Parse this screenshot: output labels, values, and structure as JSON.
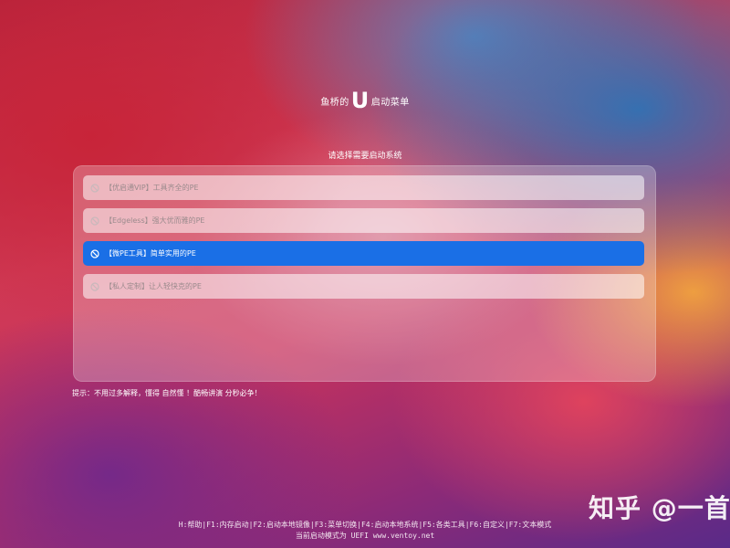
{
  "header": {
    "title_prefix": "鱼桥的",
    "title_letter": "U",
    "title_suffix": "启动菜单",
    "subtitle": "请选择需要启动系统"
  },
  "menu": {
    "items": [
      {
        "label": "【优启通VIP】工具齐全的PE",
        "icon": "no-entry-icon",
        "selected": false
      },
      {
        "label": "【Edgeless】强大优而雅的PE",
        "icon": "no-entry-icon",
        "selected": false
      },
      {
        "label": "【微PE工具】简单实用的PE",
        "icon": "no-entry-icon",
        "selected": true
      },
      {
        "label": "【私人定制】让人轻快克的PE",
        "icon": "no-entry-icon",
        "selected": false
      }
    ]
  },
  "hint": "提示：不用过多解释，懂得 自然懂 ！酷畅讲演 分秒必争！",
  "footer": {
    "keys": "H:帮助|F1:内存启动|F2:启动本地镜像|F3:菜单切换|F4:启动本地系统|F5:各类工具|F6:自定义|F7:文本模式",
    "mode": "当前启动模式为 UEFI  www.ventoy.net"
  },
  "watermark": "知乎 @一首",
  "colors": {
    "selected_bg": "#1a6fe6",
    "item_bg": "rgba(255,255,255,0.55)",
    "item_text": "#9a8a8c"
  }
}
